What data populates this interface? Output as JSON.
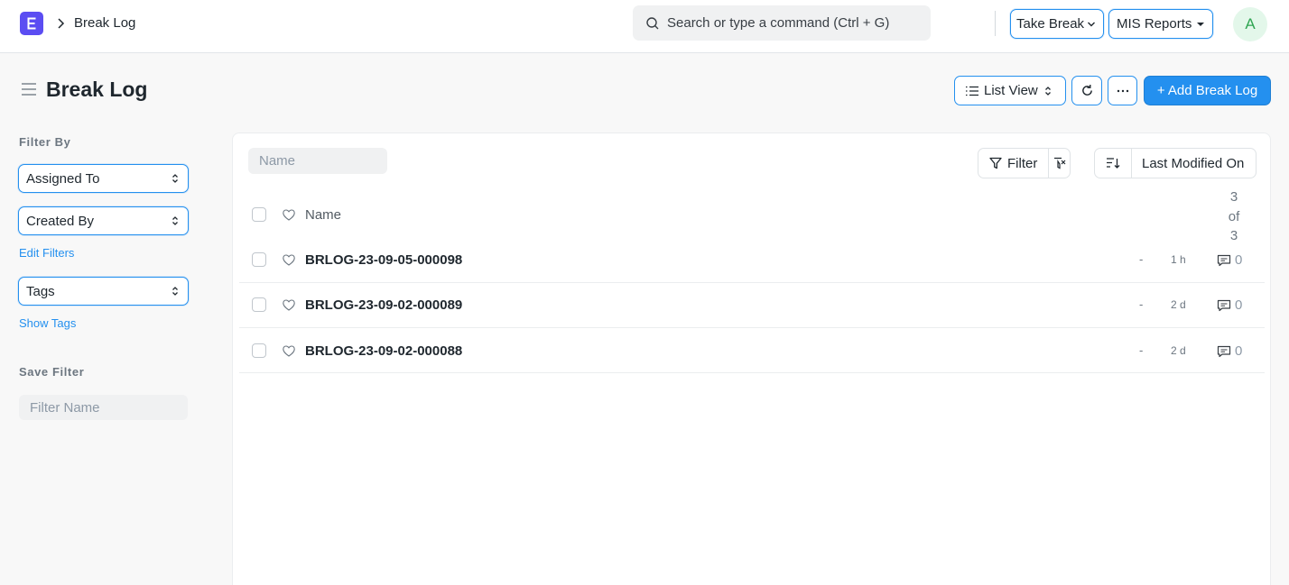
{
  "navbar": {
    "breadcrumb": "Break Log",
    "search_placeholder": "Search or type a command (Ctrl + G)",
    "take_break_label": "Take Break",
    "mis_reports_label": "MIS Reports",
    "avatar_initial": "A"
  },
  "page": {
    "title": "Break Log",
    "list_view_label": "List View",
    "add_label": "+ Add Break Log"
  },
  "sidebar": {
    "filter_by_label": "Filter By",
    "assigned_to_label": "Assigned To",
    "created_by_label": "Created By",
    "edit_filters_label": "Edit Filters",
    "tags_label": "Tags",
    "show_tags_label": "Show Tags",
    "save_filter_label": "Save Filter",
    "filter_name_placeholder": "Filter Name"
  },
  "list": {
    "name_placeholder": "Name",
    "filter_label": "Filter",
    "sort_label": "Last Modified On",
    "column_name": "Name",
    "count_lines": [
      "3",
      "of",
      "3"
    ],
    "rows": [
      {
        "title": "BRLOG-23-09-05-000098",
        "dash": "-",
        "modified": "1 h",
        "comments": "0"
      },
      {
        "title": "BRLOG-23-09-02-000089",
        "dash": "-",
        "modified": "2 d",
        "comments": "0"
      },
      {
        "title": "BRLOG-23-09-02-000088",
        "dash": "-",
        "modified": "2 d",
        "comments": "0"
      }
    ]
  },
  "colors": {
    "primary": "#2490ef",
    "logo": "#5b4df2",
    "avatar_bg": "#e3f7ea",
    "avatar_text": "#2fa552"
  }
}
